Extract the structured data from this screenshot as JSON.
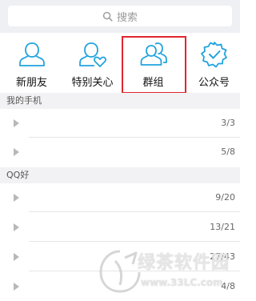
{
  "search": {
    "placeholder": "搜索",
    "icon": "search-icon"
  },
  "quick_actions": [
    {
      "label": "新朋友",
      "icon": "new-friend-icon"
    },
    {
      "label": "特别关心",
      "icon": "special-care-icon"
    },
    {
      "label": "群组",
      "icon": "group-icon",
      "highlighted": true
    },
    {
      "label": "公众号",
      "icon": "official-account-icon"
    }
  ],
  "sections": [
    {
      "title": "我的手机",
      "rows": [
        {
          "count": "3/3"
        },
        {
          "count": "5/8"
        }
      ]
    },
    {
      "title": "QQ好",
      "rows": [
        {
          "count": "9/20"
        },
        {
          "count": "13/21"
        },
        {
          "count": "27/43"
        },
        {
          "count": "4/8"
        }
      ]
    }
  ],
  "watermark": {
    "brand": "绿茶软件园",
    "url": "www.33LC.com"
  },
  "colors": {
    "icon_blue": "#21a3de",
    "highlight_red": "#e0262e",
    "background": "#eef0f4"
  }
}
